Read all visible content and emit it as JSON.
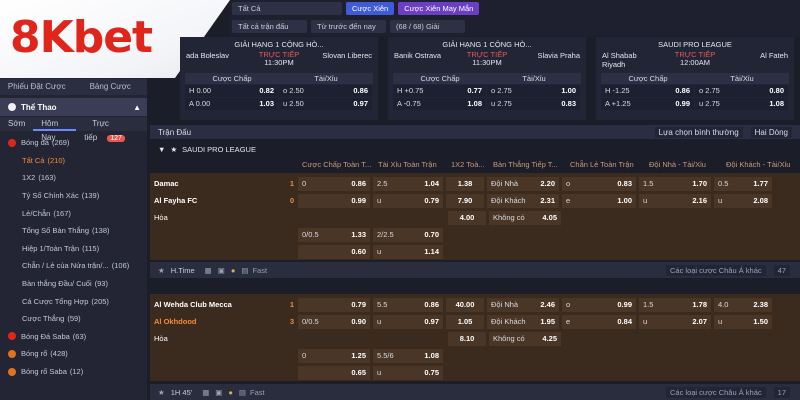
{
  "logo": {
    "text": "8Kbet"
  },
  "topbar": {
    "filter_all": "Tất Cả",
    "btn_xien": "Cược Xiên",
    "btn_xien_lucky": "Cược Xiên May Mắn",
    "filter_all_leagues": "Tất cả trận đấu",
    "sort": "Từ trước đến nay",
    "count": "(68 / 68) Giải"
  },
  "cards": [
    {
      "league": "GIẢI HẠNG 1 CỘNG HÒ...",
      "home": "ada Boleslav",
      "away": "Slovan Liberec",
      "live": "TRỰC TIẾP",
      "time": "11:30PM",
      "hdr1": "Cược Chấp",
      "hdr2": "Tài/Xỉu",
      "rows": [
        [
          "H 0.00",
          "0.82",
          "o 2.50",
          "0.86"
        ],
        [
          "A 0.00",
          "1.03",
          "u 2.50",
          "0.97"
        ]
      ]
    },
    {
      "league": "GIẢI HẠNG 1 CỘNG HÒ...",
      "home": "Banik Ostrava",
      "away": "Slavia Praha",
      "live": "TRỰC TIẾP",
      "time": "11:30PM",
      "hdr1": "Cược Chấp",
      "hdr2": "Tài/Xỉu",
      "rows": [
        [
          "H +0.75",
          "0.77",
          "o 2.75",
          "1.00"
        ],
        [
          "A -0.75",
          "1.08",
          "u 2.75",
          "0.83"
        ]
      ]
    },
    {
      "league": "SAUDI PRO LEAGUE",
      "home": "Al Shabab Riyadh",
      "away": "Al Fateh",
      "live": "TRỰC TIẾP",
      "time": "12:00AM",
      "hdr1": "Cược Chấp",
      "hdr2": "Tài/Xỉu",
      "rows": [
        [
          "H -1.25",
          "0.86",
          "o 2.75",
          "0.80"
        ],
        [
          "A +1.25",
          "0.99",
          "u 2.75",
          "1.08"
        ]
      ]
    }
  ],
  "sidebar": {
    "tabs": [
      "Phiếu Đặt Cược",
      "Bảng Cược"
    ],
    "sport": "Thể Thao",
    "sub": [
      {
        "label": "Sớm"
      },
      {
        "label": "Hôm Nay"
      },
      {
        "label": "Trực tiếp",
        "badge": "127"
      }
    ],
    "items": [
      {
        "label": "Bóng đá",
        "count": "(269)",
        "parent": true
      },
      {
        "label": "Tất Cả",
        "count": "(210)",
        "active": true
      },
      {
        "label": "1X2",
        "count": "(163)"
      },
      {
        "label": "Tỷ Số Chính Xác",
        "count": "(139)"
      },
      {
        "label": "Lẻ/Chẵn",
        "count": "(167)"
      },
      {
        "label": "Tổng Số Bàn Thắng",
        "count": "(138)"
      },
      {
        "label": "Hiệp 1/Toàn Trận",
        "count": "(115)"
      },
      {
        "label": "Chẵn / Lẻ của Nửa trận/...",
        "count": "(106)"
      },
      {
        "label": "Bàn thắng Đầu/ Cuối",
        "count": "(93)"
      },
      {
        "label": "Cá Cược Tổng Hợp",
        "count": "(205)"
      },
      {
        "label": "Cược Thắng",
        "count": "(59)"
      },
      {
        "label": "Bóng Đá Saba",
        "count": "(63)",
        "parent": true
      },
      {
        "label": "Bóng rổ",
        "count": "(428)",
        "parent": true
      },
      {
        "label": "Bóng rổ Saba",
        "count": "(12)",
        "parent": true
      }
    ]
  },
  "main": {
    "header": "Trận Đấu",
    "view": "Lựa chọn bình thường",
    "mode": "Hai Dòng",
    "league": "SAUDI PRO LEAGUE",
    "columns": [
      "Cược Chấp Toàn T...",
      "Tài Xỉu Toàn Trận",
      "1X2 Toà...",
      "Bàn Thắng Tiếp T...",
      "Chẵn Lẻ Toàn Trận",
      "Đội Nhà - Tài/Xỉu",
      "Đội Khách - Tài/Xỉu"
    ],
    "match1": {
      "home": "Damac",
      "away": "Al Fayha FC",
      "draw": "Hòa",
      "hs": "1",
      "as": "0",
      "r1": [
        "0",
        "0.86",
        "2.5",
        "1.04",
        "1.38",
        "Đội Nhà",
        "2.20",
        "o",
        "0.83",
        "1.5",
        "1.70",
        "0.5",
        "1.77"
      ],
      "r2": [
        "",
        "0.99",
        "u",
        "0.79",
        "7.90",
        "Đội Khách",
        "2.31",
        "e",
        "1.00",
        "u",
        "2.16",
        "u",
        "2.08"
      ],
      "r3": [
        "4.00",
        "Không có",
        "4.05"
      ],
      "r4": [
        "0/0.5",
        "1.33",
        "2/2.5",
        "0.70"
      ],
      "r5": [
        "0.60",
        "u",
        "1.14"
      ],
      "time": "H.Time",
      "fast": "Fast",
      "more": "Các loại cược Châu Á khác",
      "n": "47"
    },
    "match2": {
      "home": "Al Wehda Club Mecca",
      "away": "Al Okhdood",
      "draw": "Hòa",
      "hs": "1",
      "as": "3",
      "r1": [
        "0.79",
        "5.5",
        "0.86",
        "40.00",
        "Đội Nhà",
        "2.46",
        "o",
        "0.99",
        "1.5",
        "1.78",
        "4.0",
        "2.38"
      ],
      "r2": [
        "0/0.5",
        "0.90",
        "u",
        "0.97",
        "1.05",
        "Đội Khách",
        "1.95",
        "e",
        "0.84",
        "u",
        "2.07",
        "u",
        "1.50"
      ],
      "r3": [
        "8.10",
        "Không có",
        "4.25"
      ],
      "r4": [
        "0",
        "1.25",
        "5.5/6",
        "1.08"
      ],
      "r5": [
        "0.65",
        "u",
        "0.75"
      ],
      "time": "1H 45'",
      "fast": "Fast",
      "more": "Các loại cược Châu Á khác",
      "n": "17"
    }
  }
}
